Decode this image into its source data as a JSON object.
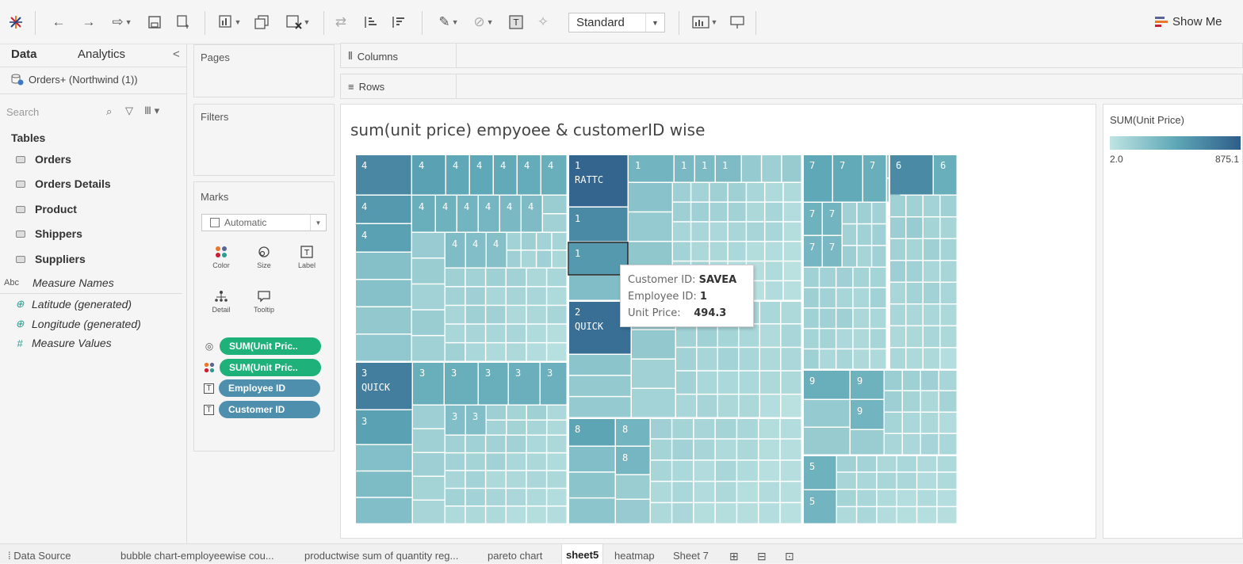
{
  "toolbar": {
    "view_mode": "Standard",
    "show_me_label": "Show Me"
  },
  "data_pane": {
    "tab_data": "Data",
    "tab_analytics": "Analytics",
    "collapse_glyph": "<",
    "data_source": "Orders+ (Northwind (1))",
    "search_placeholder": "Search",
    "tables_heading": "Tables",
    "tables": [
      "Orders",
      "Orders Details",
      "Product",
      "Shippers",
      "Suppliers"
    ],
    "fields": [
      {
        "type_glyph": "Abc",
        "name": "Measure Names"
      },
      {
        "type_glyph": "globe-icon",
        "name": "Latitude (generated)"
      },
      {
        "type_glyph": "globe-icon",
        "name": "Longitude (generated)"
      },
      {
        "type_glyph": "#",
        "name": "Measure Values"
      }
    ]
  },
  "cards": {
    "pages": "Pages",
    "filters": "Filters",
    "marks": "Marks",
    "mark_type": "Automatic",
    "mark_buttons": [
      "Color",
      "Size",
      "Label",
      "Detail",
      "Tooltip"
    ],
    "mark_pills": [
      {
        "icon": "size-icon",
        "label": "SUM(Unit Pric..",
        "color": "#1eb27a"
      },
      {
        "icon": "color-icon",
        "label": "SUM(Unit Pric..",
        "color": "#1eb27a"
      },
      {
        "icon": "label-icon",
        "label": "Employee ID",
        "color": "#4e8fad"
      },
      {
        "icon": "label-icon",
        "label": "Customer ID",
        "color": "#4e8fad"
      }
    ]
  },
  "shelves": {
    "columns": "Columns",
    "rows": "Rows"
  },
  "viz": {
    "title": "sum(unit price) empyoee & customerID wise"
  },
  "legend": {
    "title": "SUM(Unit Price)",
    "min": "2.0",
    "max": "875.1",
    "color_low": "#bfe4e3",
    "color_high": "#2e5d8a"
  },
  "tooltip": {
    "customer_label": "Customer ID:",
    "customer_value": "SAVEA",
    "employee_label": "Employee ID:",
    "employee_value": "1",
    "price_label": "Unit Price:",
    "price_value": "494.3"
  },
  "sheet_tabs": [
    "Data Source",
    "bubble chart-employeewise cou...",
    "productwise sum of quantity reg...",
    "pareto chart",
    "sheet5",
    "heatmap",
    "Sheet 7"
  ],
  "active_sheet": "sheet5",
  "chart_data": {
    "type": "treemap",
    "title": "sum(unit price) empyoee & customerID wise",
    "size_measure": "SUM(Unit Price)",
    "color_measure": "SUM(Unit Price)",
    "color_range": [
      2.0,
      875.1
    ],
    "groups_by": "Employee ID",
    "detail": "Customer ID",
    "groups": [
      {
        "employee_id": "4",
        "labels": [
          "4",
          "4",
          "4",
          "4",
          "4",
          "4",
          "4",
          "4",
          "4",
          "4",
          "4",
          "4",
          "4",
          "4",
          "4",
          "4"
        ],
        "shade": 0.45
      },
      {
        "employee_id": "3",
        "labels": [
          "3",
          "3",
          "3",
          "3",
          "3",
          "3",
          "3",
          "3",
          "3"
        ],
        "top_label": "QUICK",
        "shade": 0.42
      },
      {
        "employee_id": "1",
        "labels": [
          "1",
          "1",
          "1",
          "1",
          "1",
          "1",
          "1"
        ],
        "top_label": "RATTC",
        "shade": 0.4
      },
      {
        "employee_id": "2",
        "labels": [
          "2"
        ],
        "top_label": "QUICK",
        "shade": 0.38
      },
      {
        "employee_id": "8",
        "labels": [
          "8",
          "8",
          "8"
        ],
        "shade": 0.3
      },
      {
        "employee_id": "7",
        "labels": [
          "7",
          "7",
          "7",
          "7",
          "7",
          "7",
          "7"
        ],
        "shade": 0.35
      },
      {
        "employee_id": "6",
        "labels": [
          "6",
          "6"
        ],
        "shade": 0.32
      },
      {
        "employee_id": "9",
        "labels": [
          "9",
          "9",
          "9"
        ],
        "shade": 0.3
      },
      {
        "employee_id": "5",
        "labels": [
          "5",
          "5"
        ],
        "shade": 0.28
      }
    ],
    "highlighted": {
      "customer_id": "SAVEA",
      "employee_id": "1",
      "unit_price": 494.3
    }
  }
}
